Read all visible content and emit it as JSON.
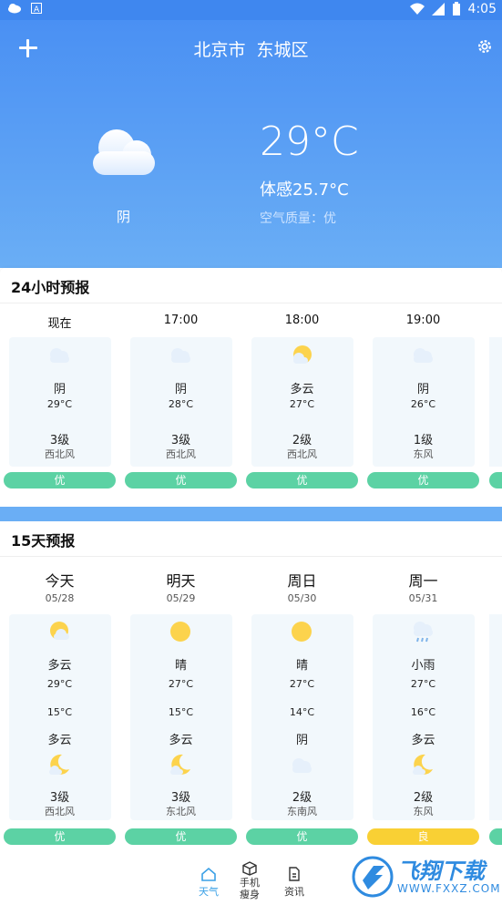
{
  "status": {
    "time": "4:05"
  },
  "header": {
    "city": "北京市  东城区",
    "condition": "阴",
    "temperature": "29°C",
    "feels_like": "体感25.7°C",
    "air_quality": "空气质量：优"
  },
  "hourly": {
    "title": "24小时预报",
    "items": [
      {
        "time": "现在",
        "condition": "阴",
        "temp": "29°C",
        "wind_level": "3级",
        "wind_dir": "西北风",
        "aqi": "优",
        "icon": "cloud-icon"
      },
      {
        "time": "17:00",
        "condition": "阴",
        "temp": "28°C",
        "wind_level": "3级",
        "wind_dir": "西北风",
        "aqi": "优",
        "icon": "cloud-icon"
      },
      {
        "time": "18:00",
        "condition": "多云",
        "temp": "27°C",
        "wind_level": "2级",
        "wind_dir": "西北风",
        "aqi": "优",
        "icon": "sun-cloud-icon"
      },
      {
        "time": "19:00",
        "condition": "阴",
        "temp": "26°C",
        "wind_level": "1级",
        "wind_dir": "东风",
        "aqi": "优",
        "icon": "cloud-icon"
      }
    ]
  },
  "daily": {
    "title": "15天预报",
    "items": [
      {
        "day": "今天",
        "date": "05/28",
        "day_cond": "多云",
        "high": "29°C",
        "low": "15°C",
        "night_cond": "多云",
        "wind_level": "3级",
        "wind_dir": "西北风",
        "aqi": "优",
        "aqi_color": "#5cd2a4",
        "day_icon": "sun-cloud-icon",
        "night_icon": "moon-cloud-icon"
      },
      {
        "day": "明天",
        "date": "05/29",
        "day_cond": "晴",
        "high": "27°C",
        "low": "15°C",
        "night_cond": "多云",
        "wind_level": "3级",
        "wind_dir": "东北风",
        "aqi": "优",
        "aqi_color": "#5cd2a4",
        "day_icon": "sun-icon",
        "night_icon": "moon-cloud-icon"
      },
      {
        "day": "周日",
        "date": "05/30",
        "day_cond": "晴",
        "high": "27°C",
        "low": "14°C",
        "night_cond": "阴",
        "wind_level": "2级",
        "wind_dir": "东南风",
        "aqi": "优",
        "aqi_color": "#5cd2a4",
        "day_icon": "sun-icon",
        "night_icon": "cloud-icon"
      },
      {
        "day": "周一",
        "date": "05/31",
        "day_cond": "小雨",
        "high": "27°C",
        "low": "16°C",
        "night_cond": "多云",
        "wind_level": "2级",
        "wind_dir": "东风",
        "aqi": "良",
        "aqi_color": "#f9d034",
        "day_icon": "rain-cloud-icon",
        "night_icon": "moon-cloud-icon"
      }
    ]
  },
  "nav": {
    "weather": "天气",
    "phone_slim": "手机\n瘦身",
    "news": "资讯"
  },
  "watermark": {
    "brand": "飞翔下载",
    "url": "WWW.FXXZ.COM"
  }
}
